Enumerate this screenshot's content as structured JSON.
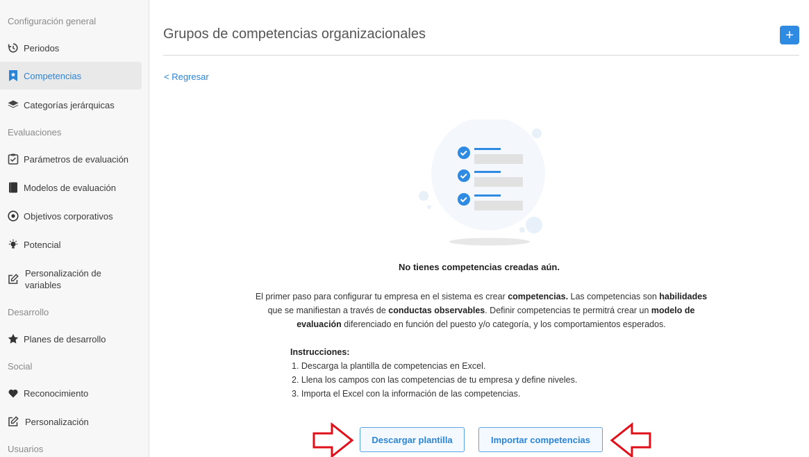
{
  "sidebar": {
    "sections": {
      "general": "Configuración general",
      "evaluations": "Evaluaciones",
      "development": "Desarrollo",
      "social": "Social",
      "users": "Usuarios"
    },
    "items": {
      "periods": "Periodos",
      "competencies": "Competencias",
      "hierarchical_categories": "Categorías jerárquicas",
      "evaluation_parameters": "Parámetros de evaluación",
      "evaluation_models": "Modelos de evaluación",
      "corporate_objectives": "Objetivos corporativos",
      "potential": "Potencial",
      "variables_customization": "Personalización de variables",
      "development_plans": "Planes de desarrollo",
      "recognition": "Reconocimiento",
      "customization": "Personalización"
    },
    "active_item": "competencies",
    "accent_color": "#2b84d6"
  },
  "header": {
    "title": "Grupos de competencias organizacionales",
    "add_label": "+"
  },
  "back_link": "< Regresar",
  "empty_state": {
    "title": "No tienes competencias creadas aún.",
    "desc": {
      "p1": "El primer paso para configurar tu empresa en el sistema es crear ",
      "b1": "competencias.",
      "p2": " Las competencias son ",
      "b2": "habilidades",
      "p3": " que se manifiestan a través de ",
      "b3": "conductas observables",
      "p4": ". Definir competencias te permitrá crear un ",
      "b4": "modelo de evaluación",
      "p5": " diferenciado en función del puesto y/o categoría, y los comportamientos esperados."
    },
    "instructions_title": "Instrucciones:",
    "instructions": [
      "1. Descarga la plantilla de competencias en Excel.",
      "2. Llena los campos con las competencias de tu empresa y define niveles.",
      "3. Importa el Excel con la información de las competencias."
    ]
  },
  "buttons": {
    "download": "Descargar plantilla",
    "import": "Importar competencias"
  },
  "colors": {
    "primary": "#2f8ae2",
    "annotation_arrow": "#e0101a"
  }
}
